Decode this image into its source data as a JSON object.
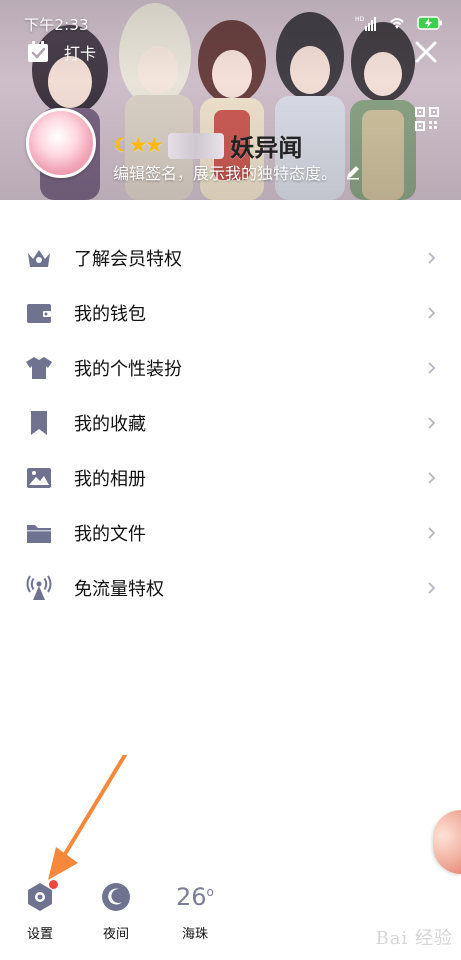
{
  "status_bar": {
    "time": "下午2:33",
    "network_badge": "HD"
  },
  "header": {
    "checkin_label": "打卡",
    "username_text": "妖异闻",
    "signature": "编辑签名，展示我的独特态度。"
  },
  "menu": {
    "items": [
      {
        "label": "了解会员特权",
        "icon": "crown-icon"
      },
      {
        "label": "我的钱包",
        "icon": "wallet-icon"
      },
      {
        "label": "我的个性装扮",
        "icon": "shirt-icon"
      },
      {
        "label": "我的收藏",
        "icon": "bookmark-icon"
      },
      {
        "label": "我的相册",
        "icon": "photo-icon"
      },
      {
        "label": "我的文件",
        "icon": "folder-icon"
      },
      {
        "label": "免流量特权",
        "icon": "antenna-icon"
      }
    ]
  },
  "bottom_bar": {
    "settings_label": "设置",
    "night_label": "夜间",
    "weather_temp": "26",
    "weather_unit": "o",
    "weather_city": "海珠"
  },
  "watermark": {
    "text": "Bai 经验"
  },
  "colors": {
    "icon_gray": "#6f7390",
    "badge_red": "#f2443d",
    "arrow_orange": "#f5883a",
    "chevron_gray": "#b5b5bf"
  }
}
